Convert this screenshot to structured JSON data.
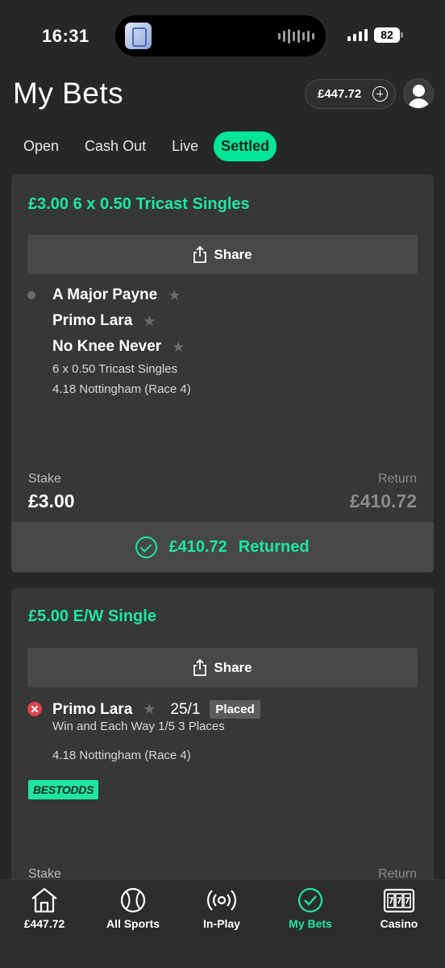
{
  "status_bar": {
    "time": "16:31",
    "battery": "82"
  },
  "header": {
    "title": "My Bets",
    "balance": "£447.72"
  },
  "tabs": [
    {
      "label": "Open"
    },
    {
      "label": "Cash Out"
    },
    {
      "label": "Live"
    },
    {
      "label": "Settled",
      "active": true
    }
  ],
  "bets": [
    {
      "title": "£3.00 6 x 0.50 Tricast Singles",
      "share_label": "Share",
      "selections": [
        "A Major Payne",
        "Primo Lara",
        "No Knee Never"
      ],
      "bet_type": "6 x 0.50 Tricast Singles",
      "event": "4.18 Nottingham (Race 4)",
      "stake_label": "Stake",
      "stake": "£3.00",
      "return_label": "Return",
      "return": "£410.72",
      "returned_amount": "£410.72",
      "returned_label": "Returned"
    },
    {
      "title": "£5.00 E/W Single",
      "share_label": "Share",
      "selection": "Primo Lara",
      "odds": "25/1",
      "result_badge": "Placed",
      "market": "Win and Each Way 1/5 3 Places",
      "event": "4.18 Nottingham (Race 4)",
      "promo_badge": "BESTODDS",
      "stake_label": "Stake",
      "return_label": "Return"
    }
  ],
  "bottom_nav": [
    {
      "label": "£447.72",
      "icon": "home-icon"
    },
    {
      "label": "All Sports",
      "icon": "tennis-ball-icon"
    },
    {
      "label": "In-Play",
      "icon": "broadcast-icon"
    },
    {
      "label": "My Bets",
      "icon": "check-circle-icon",
      "active": true
    },
    {
      "label": "Casino",
      "icon": "slot-machine-icon"
    }
  ],
  "colors": {
    "accent": "#1ee6a0",
    "background": "#262827",
    "card": "#353836",
    "lose": "#e0424a"
  }
}
